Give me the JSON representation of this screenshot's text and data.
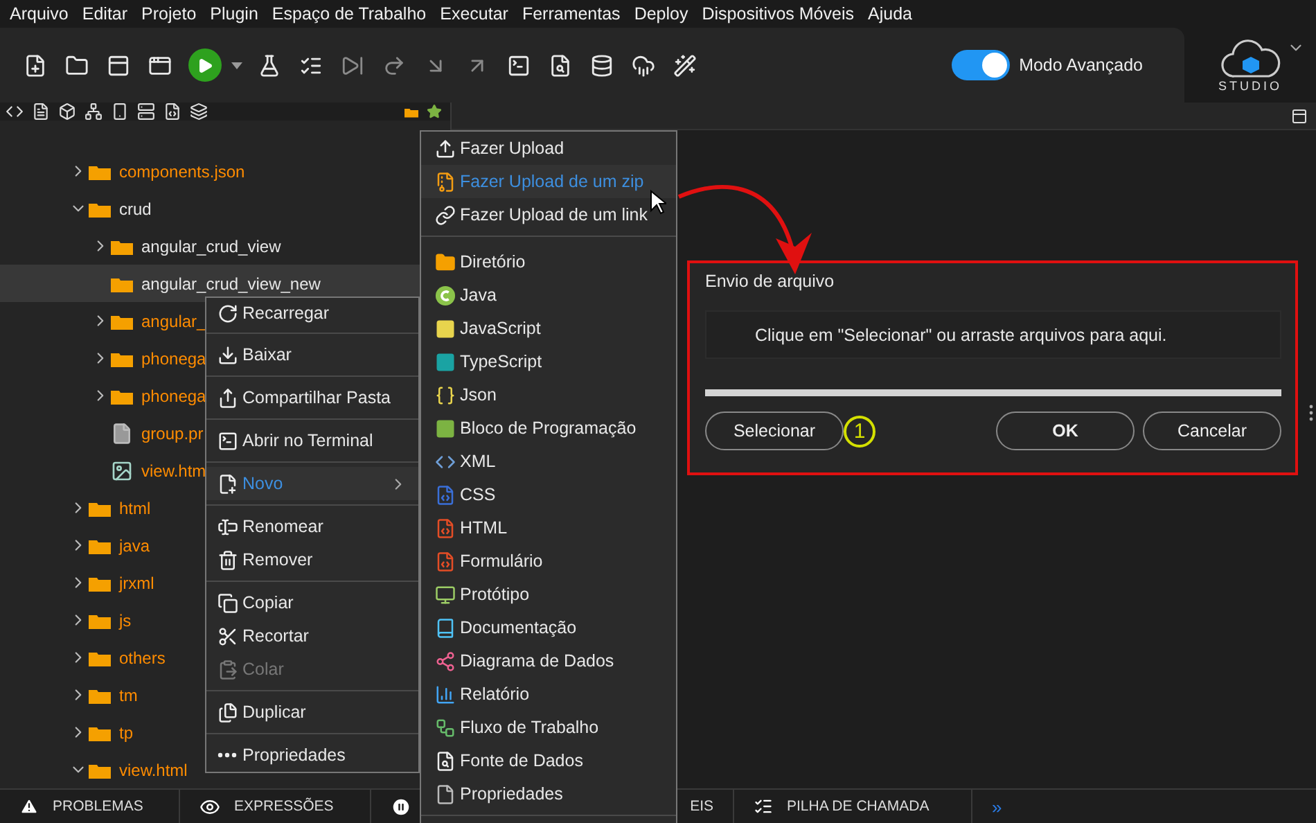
{
  "menu_bar": [
    "Arquivo",
    "Editar",
    "Projeto",
    "Plugin",
    "Espaço de Trabalho",
    "Executar",
    "Ferramentas",
    "Deploy",
    "Dispositivos Móveis",
    "Ajuda"
  ],
  "toolbar_buttons": [
    {
      "disabled": false
    },
    {
      "disabled": false
    },
    {
      "disabled": false
    },
    {
      "disabled": false
    },
    {
      "disabled": false
    },
    {
      "disabled": false
    },
    {
      "disabled": false
    },
    {
      "disabled": false
    },
    {
      "disabled": true
    },
    {
      "disabled": true
    },
    {
      "disabled": true
    },
    {
      "disabled": true
    },
    {
      "disabled": false
    },
    {
      "disabled": false
    },
    {
      "disabled": false
    },
    {
      "disabled": false
    },
    {
      "disabled": false
    }
  ],
  "advanced_mode": {
    "label": "Modo Avançado",
    "on": true
  },
  "studio_label": "STUDIO",
  "tree": [
    {
      "label": "components.json",
      "kind": "folder",
      "expanded": false,
      "selected": false,
      "color": "#ff8c00"
    },
    {
      "label": "crud",
      "kind": "folder",
      "expanded": true,
      "selected": false,
      "color": "#e6e6e6",
      "children": [
        {
          "label": "angular_crud_view",
          "kind": "folder",
          "expanded": false,
          "selected": false,
          "color": "#e6e6e6"
        },
        {
          "label": "angular_crud_view_new",
          "kind": "empty-folder",
          "selected": true,
          "color": "#e6e6e6"
        },
        {
          "label": "angular_",
          "kind": "folder",
          "expanded": false,
          "selected": false,
          "color": "#ff8c00"
        },
        {
          "label": "phonega",
          "kind": "folder",
          "expanded": false,
          "selected": false,
          "color": "#ff8c00"
        },
        {
          "label": "phonega",
          "kind": "folder",
          "expanded": false,
          "selected": false,
          "color": "#ff8c00"
        },
        {
          "label": "group.pr",
          "kind": "file",
          "selected": false,
          "color": "#ff8c00"
        },
        {
          "label": "view.htm",
          "kind": "image",
          "selected": false,
          "color": "#ff8c00"
        }
      ]
    },
    {
      "label": "html",
      "kind": "folder",
      "expanded": false,
      "selected": false,
      "color": "#ff8c00"
    },
    {
      "label": "java",
      "kind": "folder",
      "expanded": false,
      "selected": false,
      "color": "#ff8c00"
    },
    {
      "label": "jrxml",
      "kind": "folder",
      "expanded": false,
      "selected": false,
      "color": "#ff8c00"
    },
    {
      "label": "js",
      "kind": "folder",
      "expanded": false,
      "selected": false,
      "color": "#ff8c00"
    },
    {
      "label": "others",
      "kind": "folder",
      "expanded": false,
      "selected": false,
      "color": "#ff8c00"
    },
    {
      "label": "tm",
      "kind": "folder",
      "expanded": false,
      "selected": false,
      "color": "#ff8c00"
    },
    {
      "label": "tp",
      "kind": "folder",
      "expanded": false,
      "selected": false,
      "color": "#ff8c00"
    },
    {
      "label": "view.html",
      "kind": "folder",
      "expanded": true,
      "selected": false,
      "color": "#ff8c00"
    }
  ],
  "context_menu": [
    [
      {
        "label": "Recarregar",
        "selected": false,
        "disabled": false
      }
    ],
    [
      {
        "label": "Baixar",
        "selected": false,
        "disabled": false
      }
    ],
    [
      {
        "label": "Compartilhar Pasta",
        "selected": false,
        "disabled": false
      }
    ],
    [
      {
        "label": "Abrir no Terminal",
        "selected": false,
        "disabled": false
      }
    ],
    [
      {
        "label": "Novo",
        "selected": true,
        "disabled": false
      }
    ],
    [
      {
        "label": "Renomear",
        "selected": false,
        "disabled": false
      },
      {
        "label": "Remover",
        "selected": false,
        "disabled": false
      }
    ],
    [
      {
        "label": "Copiar",
        "selected": false,
        "disabled": false
      },
      {
        "label": "Recortar",
        "selected": false,
        "disabled": false
      },
      {
        "label": "Colar",
        "selected": false,
        "disabled": true
      }
    ],
    [
      {
        "label": "Duplicar",
        "selected": false,
        "disabled": false
      }
    ],
    [
      {
        "label": "Propriedades",
        "selected": false,
        "disabled": false
      }
    ]
  ],
  "submenu": [
    [
      {
        "label": "Fazer Upload",
        "selected": false
      },
      {
        "label": "Fazer Upload de um zip",
        "selected": true
      },
      {
        "label": "Fazer Upload de um link",
        "selected": false
      }
    ],
    [
      {
        "label": "Diretório",
        "selected": false
      },
      {
        "label": "Java",
        "selected": false
      },
      {
        "label": "JavaScript",
        "selected": false
      },
      {
        "label": "TypeScript",
        "selected": false
      },
      {
        "label": "Json",
        "selected": false
      },
      {
        "label": "Bloco de Programação",
        "selected": false
      },
      {
        "label": "XML",
        "selected": false
      },
      {
        "label": "CSS",
        "selected": false
      },
      {
        "label": "HTML",
        "selected": false
      },
      {
        "label": "Formulário",
        "selected": false
      },
      {
        "label": "Protótipo",
        "selected": false
      },
      {
        "label": "Documentação",
        "selected": false
      },
      {
        "label": "Diagrama de Dados",
        "selected": false
      },
      {
        "label": "Relatório",
        "selected": false
      },
      {
        "label": "Fluxo de Trabalho",
        "selected": false
      },
      {
        "label": "Fonte de Dados",
        "selected": false
      },
      {
        "label": "Propriedades",
        "selected": false
      }
    ]
  ],
  "dialog": {
    "title": "Envio de arquivo",
    "drop_hint": "Clique em \"Selecionar\" ou arraste arquivos para aqui.",
    "level": 0,
    "select_button": "Selecionar",
    "step_marker": "1",
    "ok_button": "OK",
    "cancel_button": "Cancelar"
  },
  "bottom_tabs": [
    "PROBLEMAS",
    "EXPRESSÕES",
    "EIS",
    "PILHA DE CHAMADA"
  ],
  "bottom_more": "»"
}
